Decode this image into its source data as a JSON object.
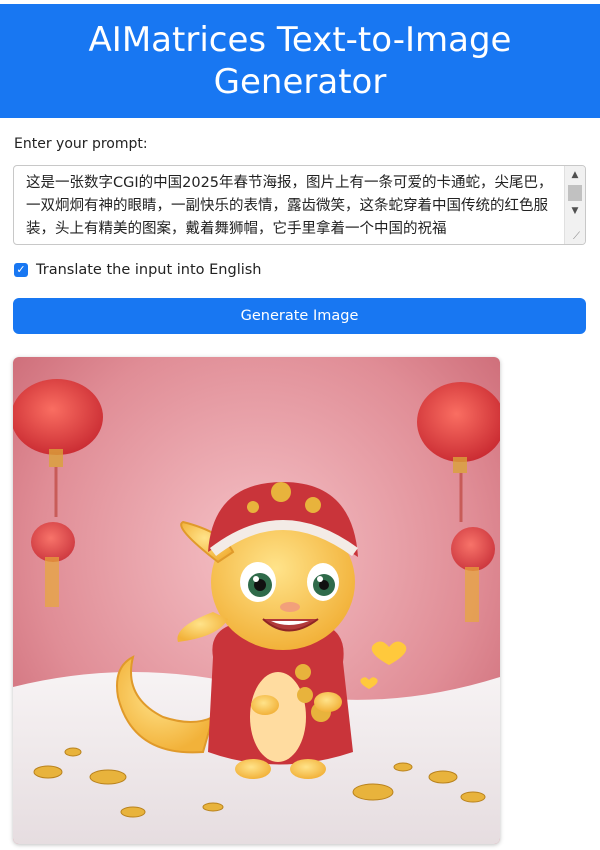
{
  "header": {
    "title": "AIMatrices Text-to-Image Generator"
  },
  "form": {
    "prompt_label": "Enter your prompt:",
    "prompt_value": "这是一张数字CGI的中国2025年春节海报，图片上有一条可爱的卡通蛇，尖尾巴，一双炯炯有神的眼睛，一副快乐的表情，露齿微笑，这条蛇穿着中国传统的红色服装，头上有精美的图案，戴着舞狮帽，它手里拿着一个中国的祝福",
    "translate_label": "Translate the input into English",
    "translate_checked": true,
    "generate_label": "Generate Image"
  },
  "result": {
    "image_description_icon": "generated-image"
  },
  "colors": {
    "accent": "#1877f2"
  }
}
